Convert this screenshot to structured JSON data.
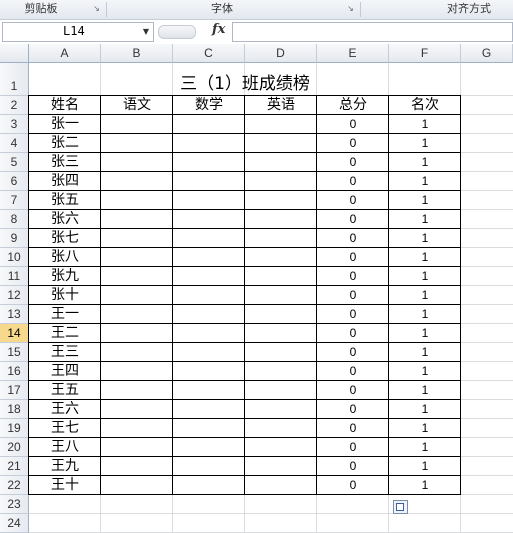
{
  "ribbon": {
    "groups": [
      {
        "label": "剪贴板"
      },
      {
        "label": "字体"
      },
      {
        "label": "对齐方式"
      }
    ]
  },
  "formula_bar": {
    "name_box": "L14",
    "fx": "fx",
    "content": ""
  },
  "columns": [
    "A",
    "B",
    "C",
    "D",
    "E",
    "F",
    "G"
  ],
  "rows": [
    "1",
    "2",
    "3",
    "4",
    "5",
    "6",
    "7",
    "8",
    "9",
    "10",
    "11",
    "12",
    "13",
    "14",
    "15",
    "16",
    "17",
    "18",
    "19",
    "20",
    "21",
    "22",
    "23",
    "24"
  ],
  "selected_row": "14",
  "sheet": {
    "title": "三（1）班成绩榜",
    "headers": [
      "姓名",
      "语文",
      "数学",
      "英语",
      "总分",
      "名次"
    ],
    "students": [
      {
        "name": "张一",
        "total": "0",
        "rank": "1"
      },
      {
        "name": "张二",
        "total": "0",
        "rank": "1"
      },
      {
        "name": "张三",
        "total": "0",
        "rank": "1"
      },
      {
        "name": "张四",
        "total": "0",
        "rank": "1"
      },
      {
        "name": "张五",
        "total": "0",
        "rank": "1"
      },
      {
        "name": "张六",
        "total": "0",
        "rank": "1"
      },
      {
        "name": "张七",
        "total": "0",
        "rank": "1"
      },
      {
        "name": "张八",
        "total": "0",
        "rank": "1"
      },
      {
        "name": "张九",
        "total": "0",
        "rank": "1"
      },
      {
        "name": "张十",
        "total": "0",
        "rank": "1"
      },
      {
        "name": "王一",
        "total": "0",
        "rank": "1"
      },
      {
        "name": "王二",
        "total": "0",
        "rank": "1"
      },
      {
        "name": "王三",
        "total": "0",
        "rank": "1"
      },
      {
        "name": "王四",
        "total": "0",
        "rank": "1"
      },
      {
        "name": "王五",
        "total": "0",
        "rank": "1"
      },
      {
        "name": "王六",
        "total": "0",
        "rank": "1"
      },
      {
        "name": "王七",
        "total": "0",
        "rank": "1"
      },
      {
        "name": "王八",
        "total": "0",
        "rank": "1"
      },
      {
        "name": "王九",
        "total": "0",
        "rank": "1"
      },
      {
        "name": "王十",
        "total": "0",
        "rank": "1"
      }
    ]
  },
  "icons": {
    "paste_options": "paste-options-icon",
    "dropdown": "chevron-down-icon",
    "launcher": "dialog-launcher-icon"
  },
  "colors": {
    "selected_row_header": "#f7d98b",
    "gridline": "#dadcdd",
    "header_bg": "#e4e8ee"
  }
}
